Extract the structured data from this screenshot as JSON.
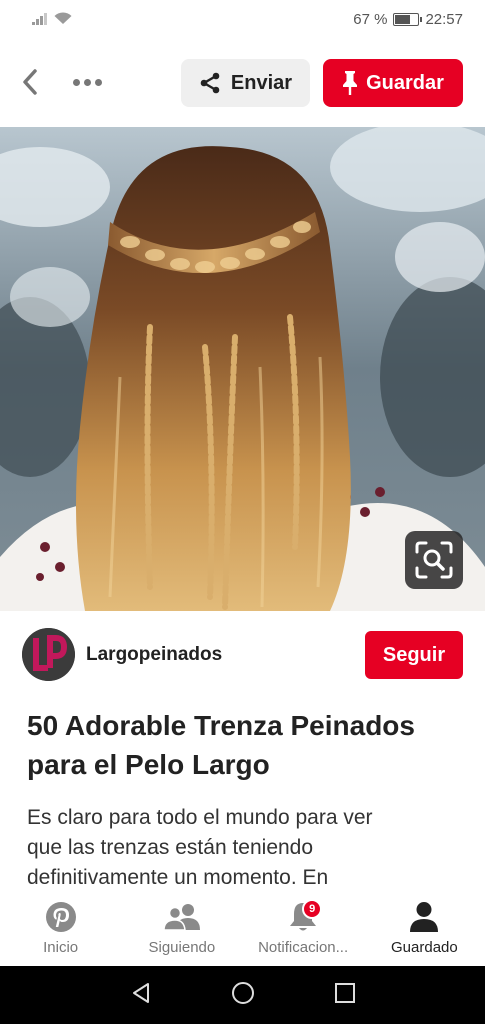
{
  "status_bar": {
    "battery_text": "67 %",
    "battery_level": 0.67,
    "time": "22:57"
  },
  "toolbar": {
    "send_label": "Enviar",
    "save_label": "Guardar"
  },
  "creator": {
    "name": "Largopeinados",
    "follow_label": "Seguir"
  },
  "pin": {
    "title": "50 Adorable Trenza Peinados para el Pelo Largo",
    "description": "Es claro para todo el mundo para ver que las trenzas están teniendo definitivamente un momento. En"
  },
  "tabs": [
    {
      "label": "Inicio",
      "icon": "pinterest-icon"
    },
    {
      "label": "Siguiendo",
      "icon": "people-icon"
    },
    {
      "label": "Notificacion...",
      "icon": "bell-icon",
      "badge": "9"
    },
    {
      "label": "Guardado",
      "icon": "person-icon"
    }
  ],
  "colors": {
    "accent": "#e60023",
    "secondary_button": "#efefef"
  }
}
